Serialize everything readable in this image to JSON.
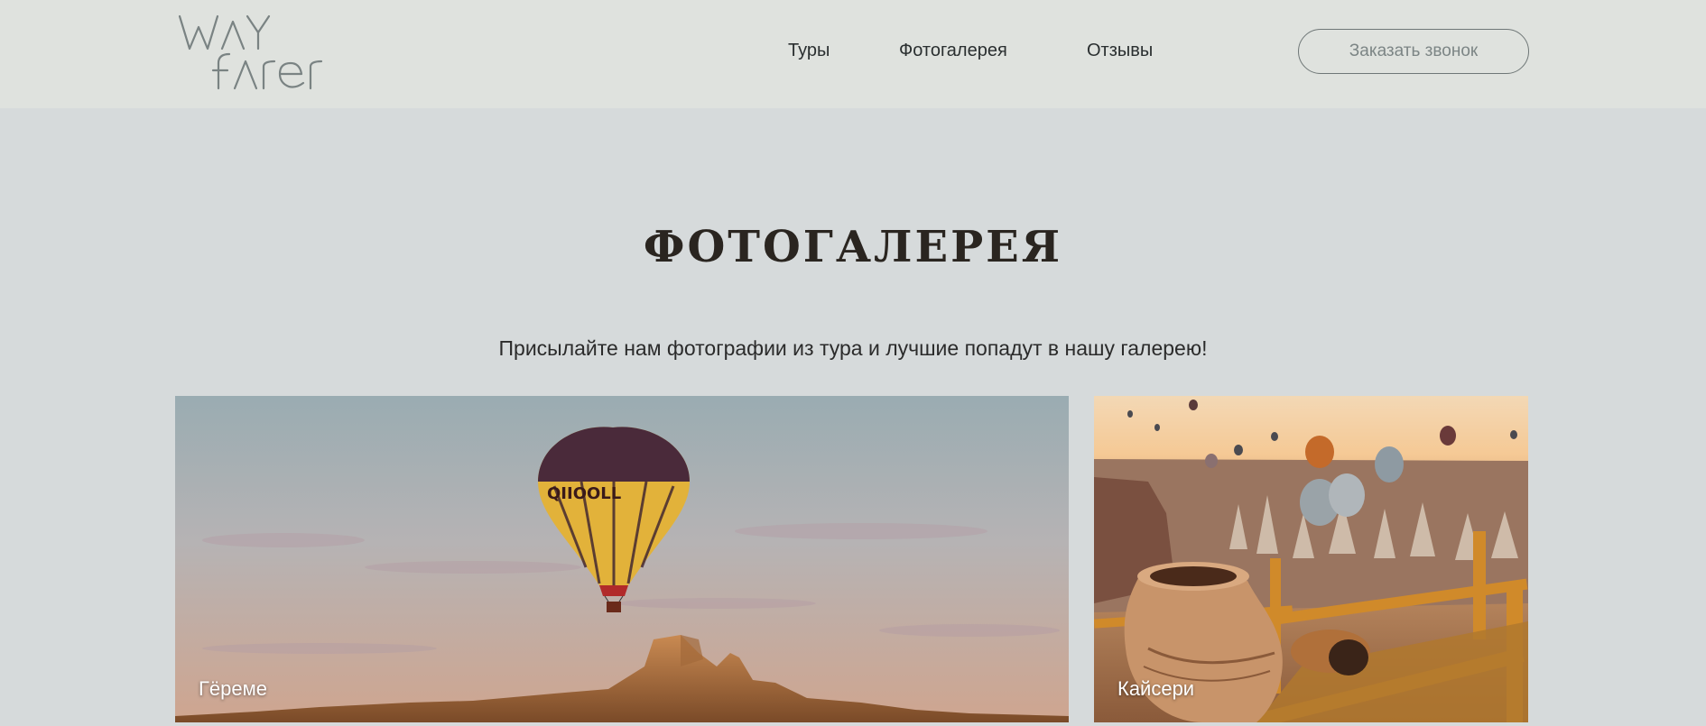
{
  "header": {
    "logo_text": "WAY FARER",
    "nav": {
      "tours": "Туры",
      "gallery": "Фотогалерея",
      "reviews": "Отзывы"
    },
    "call_button": "Заказать звонок"
  },
  "main": {
    "title": "ФОТОГАЛЕРЕЯ",
    "subtitle": "Присылайте нам фотографии из тура и лучшие попадут в нашу галерею!",
    "photos": [
      {
        "caption": "Гёреме"
      },
      {
        "caption": "Кайсери"
      }
    ]
  },
  "colors": {
    "page_bg": "#d6dadb",
    "header_bg": "#dfe2de",
    "title": "#2a2520"
  }
}
